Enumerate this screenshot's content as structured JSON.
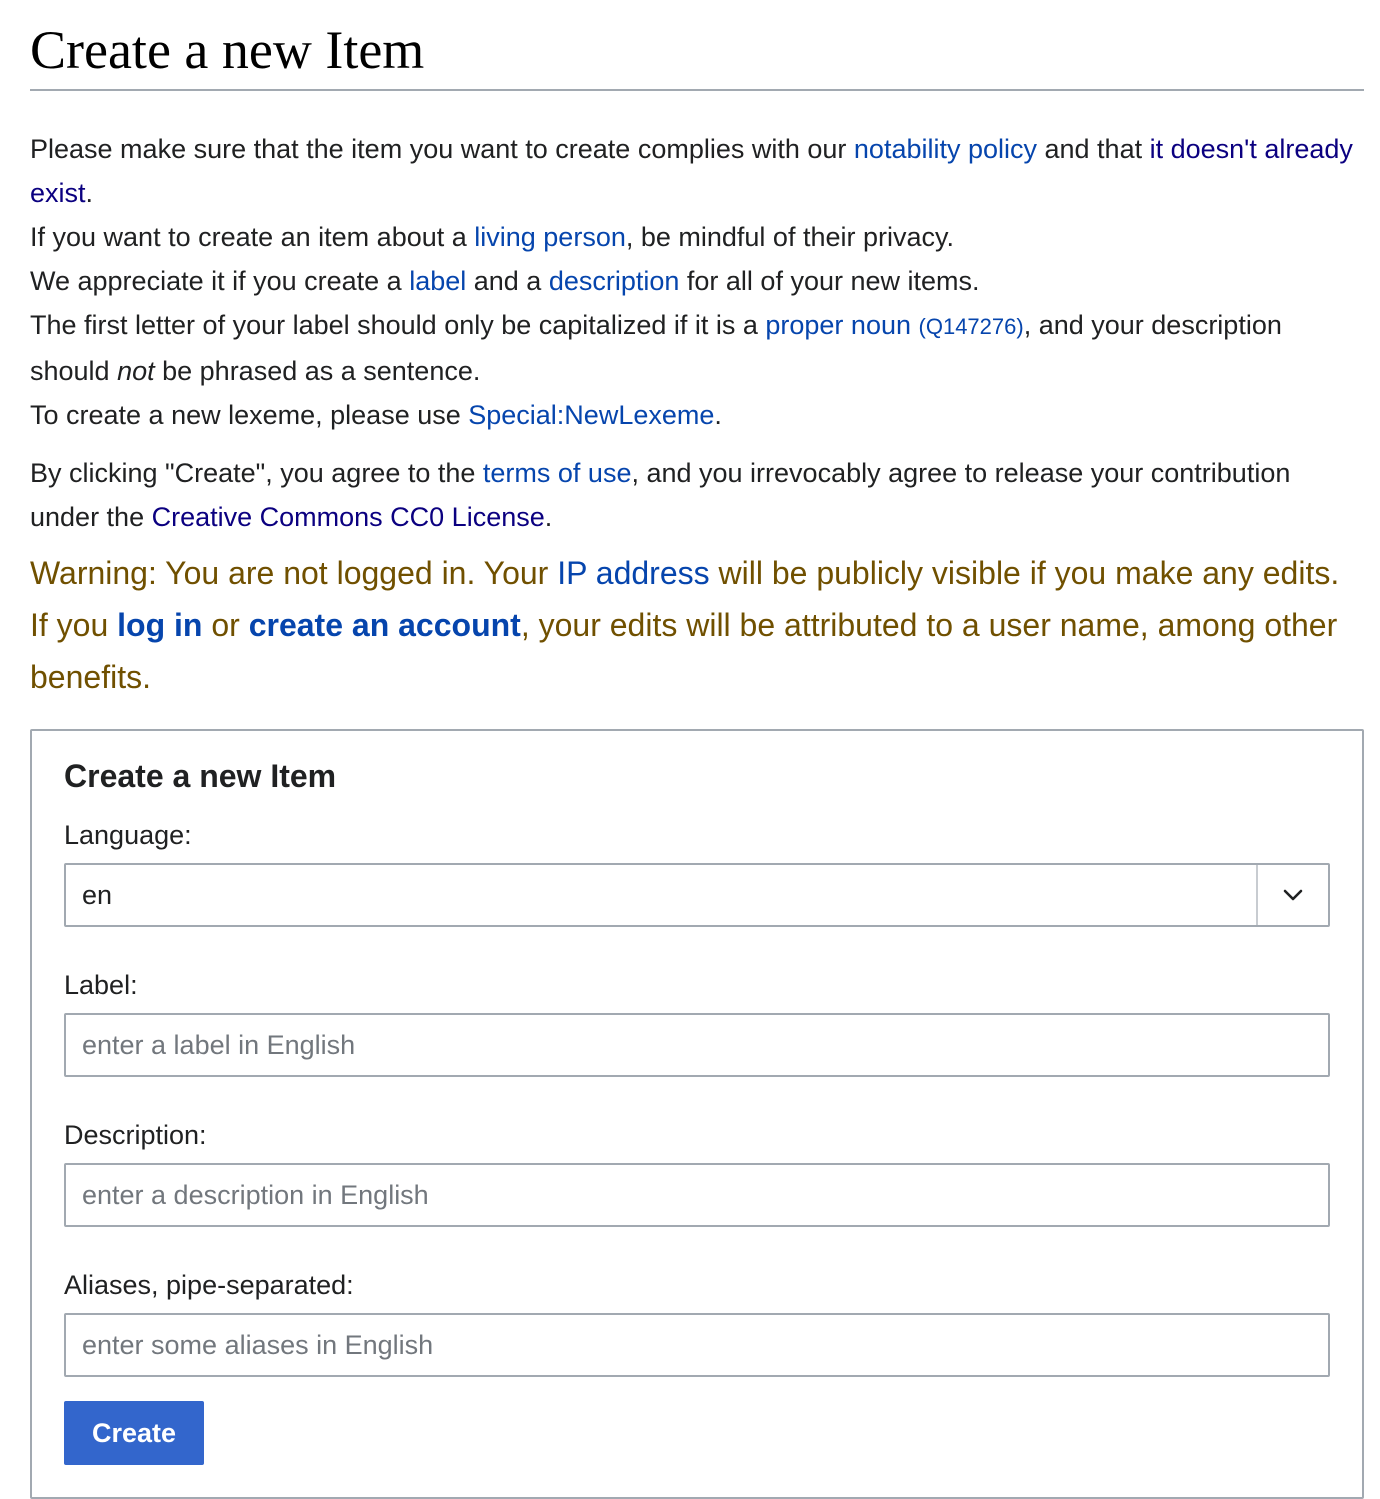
{
  "page": {
    "title": "Create a new Item"
  },
  "intro": {
    "p1": {
      "before": "Please make sure that the item you want to create complies with our ",
      "link1": "notability policy",
      "middle": " and that ",
      "link2": "it doesn't already exist",
      "after": "."
    },
    "p2": {
      "before": "If you want to create an item about a ",
      "link": "living person",
      "after": ", be mindful of their privacy."
    },
    "p3": {
      "before": "We appreciate it if you create a ",
      "link1": "label",
      "middle": " and a ",
      "link2": "description",
      "after": " for all of your new items."
    },
    "p4": {
      "before": "The first letter of your label should only be capitalized if it is a ",
      "link": "proper noun",
      "qid": "(Q147276)",
      "middle": ", and your description should ",
      "emph": "not",
      "after": " be phrased as a sentence."
    },
    "p5": {
      "before": "To create a new lexeme, please use ",
      "link": "Special:NewLexeme",
      "after": "."
    },
    "p6": {
      "before": "By clicking \"Create\", you agree to the ",
      "link1": "terms of use",
      "middle": ", and you irrevocably agree to release your contribution under the ",
      "link2": "Creative Commons CC0 License",
      "after": "."
    }
  },
  "warning": {
    "before": "Warning: You are not logged in. Your ",
    "ip_link": "IP address",
    "middle1": " will be publicly visible if you make any edits. If you ",
    "login_link": "log in",
    "middle2": " or ",
    "account_link": "create an account",
    "after": ", your edits will be attributed to a user name, among other benefits."
  },
  "form": {
    "legend": "Create a new Item",
    "language_label": "Language:",
    "language_value": "en",
    "label_label": "Label:",
    "label_placeholder": "enter a label in English",
    "description_label": "Description:",
    "description_placeholder": "enter a description in English",
    "aliases_label": "Aliases, pipe-separated:",
    "aliases_placeholder": "enter some aliases in English",
    "create_button": "Create"
  },
  "colors": {
    "link": "#0645ad",
    "visited_link": "#0b0080",
    "warning_text": "#705000",
    "button_bg": "#3366cc",
    "border": "#a2a9b1"
  },
  "icons": {
    "dropdown": "chevron-down-icon"
  }
}
